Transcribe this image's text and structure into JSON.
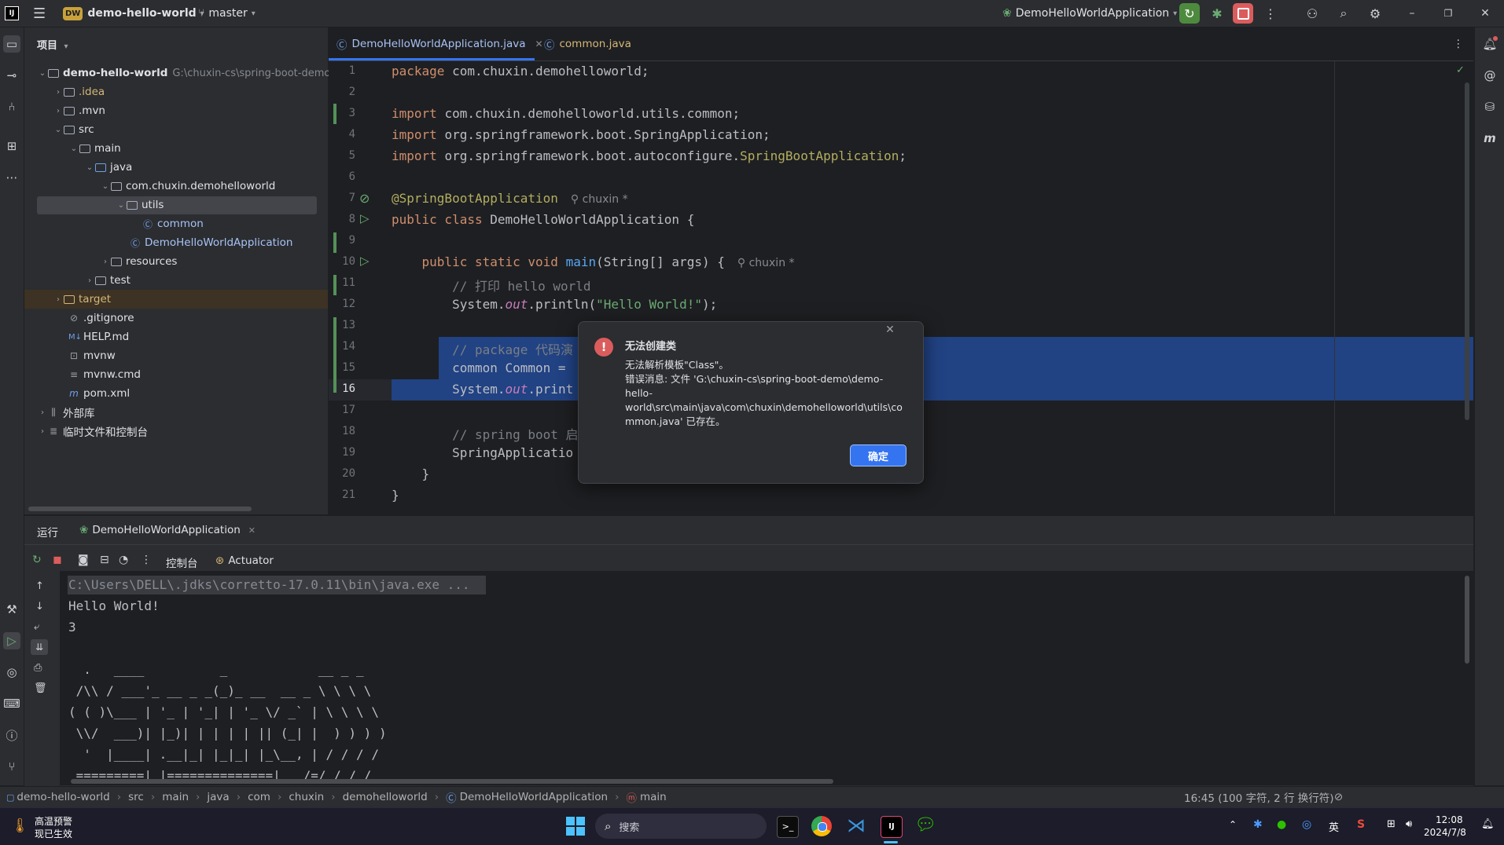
{
  "titlebar": {
    "project_badge": "DW",
    "project_name": "demo-hello-world",
    "branch": "master",
    "run_config": "DemoHelloWorldApplication"
  },
  "project_panel": {
    "title": "项目",
    "root_name": "demo-hello-world",
    "root_path": "G:\\chuxin-cs\\spring-boot-demo",
    "items": [
      {
        "label": "idea_dir",
        "text": ".idea"
      },
      {
        "label": "mvn_dir",
        "text": ".mvn"
      },
      {
        "label": "src",
        "text": "src"
      },
      {
        "label": "main",
        "text": "main"
      },
      {
        "label": "java",
        "text": "java"
      },
      {
        "label": "pkg",
        "text": "com.chuxin.demohelloworld"
      },
      {
        "label": "utils",
        "text": "utils"
      },
      {
        "label": "common",
        "text": "common"
      },
      {
        "label": "app",
        "text": "DemoHelloWorldApplication"
      },
      {
        "label": "resources",
        "text": "resources"
      },
      {
        "label": "test",
        "text": "test"
      },
      {
        "label": "target",
        "text": "target"
      },
      {
        "label": "gitignore",
        "text": ".gitignore"
      },
      {
        "label": "help",
        "text": "HELP.md"
      },
      {
        "label": "mvnw",
        "text": "mvnw"
      },
      {
        "label": "mvnwcmd",
        "text": "mvnw.cmd"
      },
      {
        "label": "pom",
        "text": "pom.xml"
      },
      {
        "label": "ext",
        "text": "外部库"
      },
      {
        "label": "scratch",
        "text": "临时文件和控制台"
      }
    ]
  },
  "editor": {
    "tabs": [
      {
        "title": "DemoHelloWorldApplication.java"
      },
      {
        "title": "common.java"
      }
    ],
    "line_numbers": [
      "1",
      "2",
      "3",
      "4",
      "5",
      "6",
      "7",
      "8",
      "9",
      "10",
      "11",
      "12",
      "13",
      "14",
      "15",
      "16",
      "17",
      "18",
      "19",
      "20",
      "21"
    ],
    "author_hint": "chuxin *",
    "code": {
      "l1a": "package ",
      "l1b": "com.chuxin.demohelloworld;",
      "l3a": "import ",
      "l3b": "com.chuxin.demohelloworld.utils.common;",
      "l4a": "import ",
      "l4b": "org.springframework.boot.SpringApplication;",
      "l5a": "import ",
      "l5b": "org.springframework.boot.autoconfigure.",
      "l5c": "SpringBootApplication",
      "l5d": ";",
      "l7": "@SpringBootApplication",
      "l8a": "public class ",
      "l8b": "DemoHelloWorldApplication {",
      "l10a": "    public static void ",
      "l10b": "main",
      "l10c": "(String[] args) {",
      "l11": "        // 打印 hello world",
      "l12a": "        System.",
      "l12b": "out",
      "l12c": ".println(",
      "l12d": "\"Hello World!\"",
      "l12e": ");",
      "l14": "        // package 代码演",
      "l15": "        common Common = ",
      "l16a": "        System.",
      "l16b": "out",
      "l16c": ".print",
      "l18": "        // spring boot 启",
      "l19a": "        SpringApplicatio",
      "l19b": ";",
      "l20": "    }",
      "l21": "}"
    }
  },
  "dialog": {
    "title": "无法创建类",
    "line1": "无法解析模板\"Class\"。",
    "line2": "错误消息: 文件 'G:\\chuxin-cs\\spring-boot-demo\\demo-",
    "line3": "hello-",
    "line4": "world\\src\\main\\java\\com\\chuxin\\demohelloworld\\utils\\co",
    "line5": "mmon.java' 已存在。",
    "ok_label": "确定"
  },
  "run_panel": {
    "title": "运行",
    "tab": "DemoHelloWorldApplication",
    "console_tab": "控制台",
    "actuator_tab": "Actuator",
    "lines": [
      "C:\\Users\\DELL\\.jdks\\corretto-17.0.11\\bin\\java.exe ...",
      "Hello World!",
      "3",
      "",
      "  .   ____          _            __ _ _",
      " /\\\\ / ___'_ __ _ _(_)_ __  __ _ \\ \\ \\ \\",
      "( ( )\\___ | '_ | '_| | '_ \\/ _` | \\ \\ \\ \\",
      " \\\\/  ___)| |_)| | | | | || (_| |  ) ) ) )",
      "  '  |____| .__|_| |_|_| |_\\__, | / / / /",
      " =========|_|==============|___/=/_/_/_/"
    ]
  },
  "statusbar": {
    "crumbs": [
      "demo-hello-world",
      "src",
      "main",
      "java",
      "com",
      "chuxin",
      "demohelloworld",
      "DemoHelloWorldApplication",
      "main"
    ],
    "position": "16:45 (100 字符, 2 行 换行符)"
  },
  "taskbar": {
    "weather_title": "高温预警",
    "weather_sub": "现已生效",
    "search": "搜索",
    "ime": "英",
    "time": "12:08",
    "date": "2024/7/8"
  },
  "colors": {
    "accent": "#3574f0",
    "error": "#db5c5c",
    "selection": "#214283"
  }
}
